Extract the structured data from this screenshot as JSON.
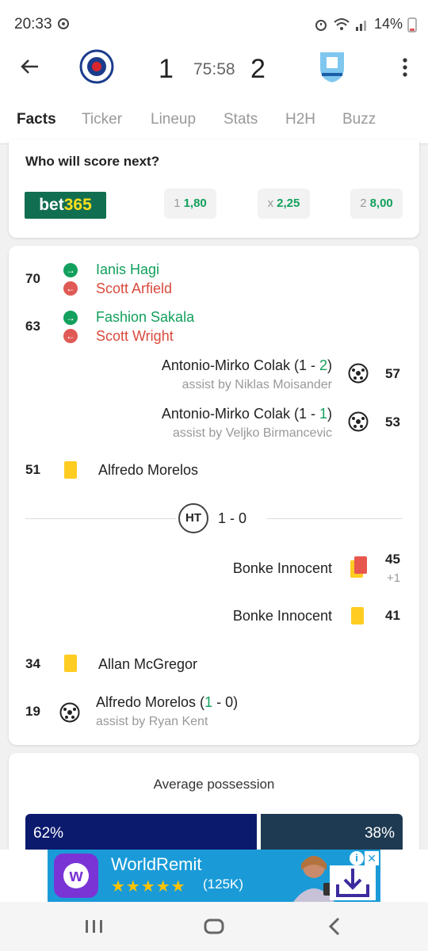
{
  "status_bar": {
    "time": "20:33",
    "battery": "14%"
  },
  "match": {
    "home_score": "1",
    "away_score": "2",
    "clock": "75:58",
    "home_crest": "rangers-crest-icon",
    "away_crest": "malmo-crest-icon"
  },
  "tabs": [
    "Facts",
    "Ticker",
    "Lineup",
    "Stats",
    "H2H",
    "Buzz"
  ],
  "odds": {
    "title": "Who will score next?",
    "bookmaker_a": "bet",
    "bookmaker_b": "365",
    "options": [
      {
        "key": "1",
        "value": "1,80"
      },
      {
        "key": "x",
        "value": "2,25"
      },
      {
        "key": "2",
        "value": "8,00"
      }
    ]
  },
  "events": {
    "sub70": {
      "minute": "70",
      "in": "Ianis Hagi",
      "out": "Scott Arfield"
    },
    "sub63": {
      "minute": "63",
      "in": "Fashion Sakala",
      "out": "Scott Wright"
    },
    "goal57": {
      "minute": "57",
      "player": "Antonio-Mirko Colak (1 - ",
      "score_hl": "2",
      "close": ")",
      "assist": "assist by Niklas Moisander"
    },
    "goal53": {
      "minute": "53",
      "player": "Antonio-Mirko Colak (1 - ",
      "score_hl": "1",
      "close": ")",
      "assist": "assist by Veljko Birmancevic"
    },
    "card51": {
      "minute": "51",
      "player": "Alfredo Morelos"
    },
    "halftime": {
      "label": "HT",
      "score": "1 - 0"
    },
    "card45": {
      "minute": "45",
      "extra": "+1",
      "player": "Bonke Innocent"
    },
    "card41": {
      "minute": "41",
      "player": "Bonke Innocent"
    },
    "card34": {
      "minute": "34",
      "player": "Allan McGregor"
    },
    "goal19": {
      "minute": "19",
      "player_pre": "Alfredo Morelos (",
      "score_hl": "1",
      "player_post": " - 0)",
      "assist": "assist by Ryan Kent"
    }
  },
  "possession": {
    "title": "Average possession",
    "home": "62%",
    "away": "38%"
  },
  "ad": {
    "title": "WorldRemit",
    "stars": "★★★★★",
    "reviews": "(125K)"
  },
  "colors": {
    "accent": "#12a05c",
    "red": "#d94a3c",
    "yellow": "#ffcc22",
    "home_bar": "#0c1a6e",
    "away_bar": "#1e3a52"
  }
}
